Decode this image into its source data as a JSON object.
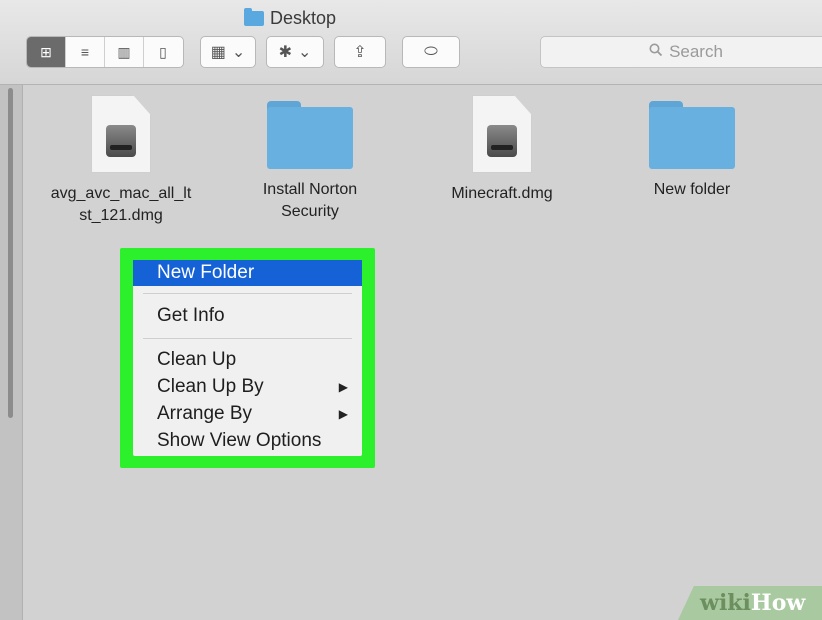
{
  "window": {
    "title": "Desktop",
    "title_icon": "folder-icon"
  },
  "toolbar": {
    "view_buttons": [
      {
        "name": "icon-view",
        "glyph": "⊞",
        "active": true
      },
      {
        "name": "list-view",
        "glyph": "≡",
        "active": false
      },
      {
        "name": "column-view",
        "glyph": "▥",
        "active": false
      },
      {
        "name": "cover-flow-view",
        "glyph": "▯",
        "active": false
      }
    ],
    "arrange_glyph": "▦",
    "action_glyph": "✱",
    "share_glyph": "⇪",
    "tag_glyph": "⬭",
    "dropdown_glyph": "⌄"
  },
  "search": {
    "placeholder": "Search",
    "icon": "search-icon"
  },
  "files": [
    {
      "name": "avg_avc_mac_all_lt\nst_121.dmg",
      "type": "dmg"
    },
    {
      "name": "Install Norton\nSecurity",
      "type": "folder"
    },
    {
      "name": "Minecraft.dmg",
      "type": "dmg"
    },
    {
      "name": "New folder",
      "type": "folder"
    }
  ],
  "context_menu": {
    "items": [
      {
        "label": "New Folder",
        "selected": true,
        "submenu": false
      },
      {
        "label": "Get Info",
        "selected": false,
        "submenu": false
      },
      {
        "label": "Clean Up",
        "selected": false,
        "submenu": false
      },
      {
        "label": "Clean Up By",
        "selected": false,
        "submenu": true
      },
      {
        "label": "Arrange By",
        "selected": false,
        "submenu": true
      },
      {
        "label": "Show View Options",
        "selected": false,
        "submenu": false
      }
    ],
    "submenu_glyph": "▶"
  },
  "watermark": {
    "brand_part1": "wiki",
    "brand_part2": "How"
  },
  "colors": {
    "highlight": "#2cf02c",
    "selection": "#1561d6",
    "folder": "#67b0e0"
  }
}
